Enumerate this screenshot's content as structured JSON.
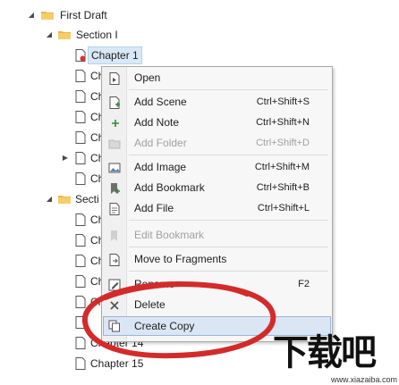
{
  "tree": {
    "first_draft": "First Draft",
    "section_1": "Section I",
    "chapter_1": "Chapter 1",
    "partial_ch": "Ch",
    "partial_section": "Secti",
    "chapter_14": "Chapter 14",
    "chapter_15": "Chapter 15"
  },
  "menu": {
    "open": "Open",
    "add_scene": "Add Scene",
    "add_scene_sc": "Ctrl+Shift+S",
    "add_note": "Add Note",
    "add_note_sc": "Ctrl+Shift+N",
    "add_folder": "Add Folder",
    "add_folder_sc": "Ctrl+Shift+D",
    "add_image": "Add Image",
    "add_image_sc": "Ctrl+Shift+M",
    "add_bookmark": "Add Bookmark",
    "add_bookmark_sc": "Ctrl+Shift+B",
    "add_file": "Add File",
    "add_file_sc": "Ctrl+Shift+L",
    "edit_bookmark": "Edit Bookmark",
    "move_to_fragments": "Move to Fragments",
    "rename": "Rename",
    "rename_sc": "F2",
    "delete": "Delete",
    "create_copy": "Create Copy"
  },
  "watermark": {
    "brand": "下载吧",
    "url": "www.xiazaiba.com"
  },
  "colors": {
    "highlight_oval": "#d42a2a",
    "selection": "#d9e8f7",
    "menu_background": "#f7f7f7"
  }
}
